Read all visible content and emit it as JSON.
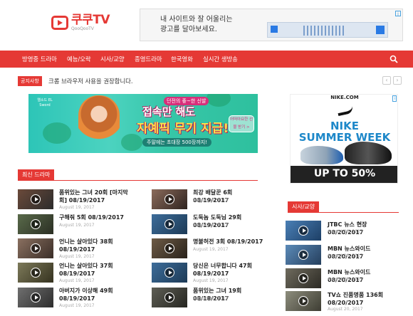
{
  "site": {
    "logo_title": "쿠쿠TV",
    "logo_sub": "QooQooTV",
    "accent": "#e53935"
  },
  "top_ad": {
    "line1": "내 사이트와 잘 어울리는",
    "line2": "광고를 달아보세요."
  },
  "nav": {
    "items": [
      "방영중 드라마",
      "예능/오락",
      "시사/교양",
      "종영드라마",
      "한국영화",
      "실시간 생방송"
    ]
  },
  "notice": {
    "label": "공지사항",
    "text": "크롬 브라우저 사용을 권장합니다."
  },
  "banner_ad": {
    "brand": "엘소드 EL Sword",
    "line1": "던전의 좋~한 신발",
    "line2": "접속만 해도",
    "line3": "자예픽 무기 지급!",
    "line4": "주말에는 초대장 500장까지!",
    "cta": "어떠아요한 선물 받기 >"
  },
  "latest": {
    "label": "최신 드라마",
    "left": [
      {
        "title": "품위있는 그녀 20회 [마지막회] 08/19/2017",
        "date": "August 19, 2017"
      },
      {
        "title": "구해줘 5회 08/19/2017",
        "date": "August 19, 2017"
      },
      {
        "title": "언니는 살아있다 38회 08/19/2017",
        "date": "August 19, 2017"
      },
      {
        "title": "언니는 살아있다 37회 08/19/2017",
        "date": "August 19, 2017"
      },
      {
        "title": "아버지가 이상해 49회 08/19/2017",
        "date": "August 19, 2017"
      }
    ],
    "right": [
      {
        "title": "최강 배달꾼 6회 08/19/2017",
        "date": "August 19, 2017"
      },
      {
        "title": "도둑놈 도둑님 29회 08/19/2017",
        "date": "August 19, 2017"
      },
      {
        "title": "명불허전 3회 08/19/2017",
        "date": "August 19, 2017"
      },
      {
        "title": "당신은 너무합니다 47회 08/19/2017",
        "date": "August 19, 2017"
      },
      {
        "title": "품위있는 그녀 19회 08/18/2017",
        "date": "August 18, 2017"
      }
    ]
  },
  "nike_ad": {
    "url": "NIKE.COM",
    "title_line1": "NIKE",
    "title_line2": "SUMMER WEEK",
    "sale": "UP TO 50%"
  },
  "sisa": {
    "label": "시사/교양",
    "items": [
      {
        "title": "JTBC 뉴스 현장 08/20/2017",
        "date": "August 20, 2017"
      },
      {
        "title": "MBN 뉴스와이드 08/20/2017",
        "date": "August 20, 2017"
      },
      {
        "title": "MBN 뉴스와이드 08/20/2017",
        "date": "August 20, 2017"
      },
      {
        "title": "TV쇼 진품명품 136회 08/20/2017",
        "date": "August 20, 2017"
      }
    ]
  }
}
